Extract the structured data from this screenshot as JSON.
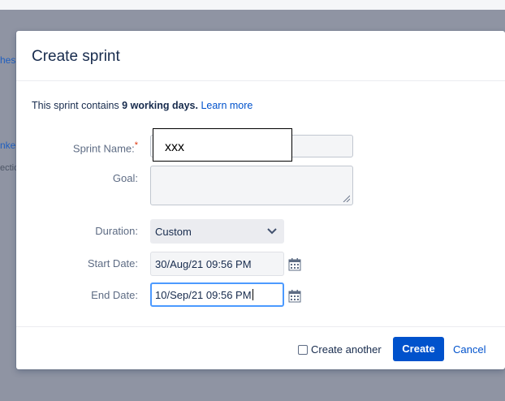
{
  "background": {
    "link_text_1": "hes",
    "link_text_2": "nke",
    "sub_text": "ectio"
  },
  "modal": {
    "title": "Create sprint",
    "info": {
      "prefix": "This sprint contains ",
      "bold": "9 working days.",
      "link": "Learn more"
    },
    "fields": {
      "sprint_name_label": "Sprint Name:",
      "required_mark": "*",
      "sprint_name_value": "xxx",
      "goal_label": "Goal:",
      "goal_value": "",
      "duration_label": "Duration:",
      "duration_value": "Custom",
      "start_label": "Start Date:",
      "start_value": "30/Aug/21 09:56 PM",
      "end_label": "End Date:",
      "end_value": "10/Sep/21 09:56 PM"
    },
    "footer": {
      "checkbox_label": "Create another",
      "create_label": "Create",
      "cancel_label": "Cancel"
    }
  }
}
